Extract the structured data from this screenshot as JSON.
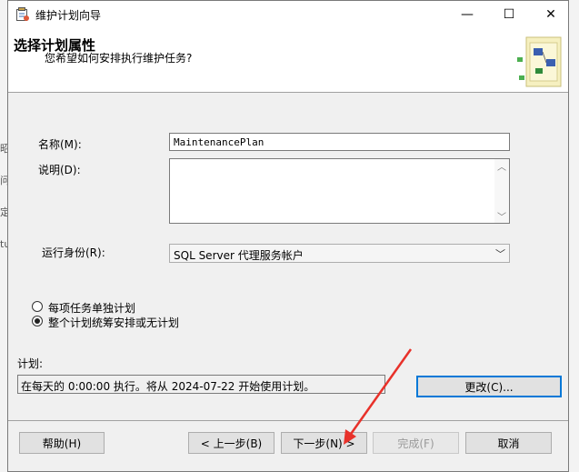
{
  "window": {
    "title": "维护计划向导",
    "controls": {
      "minimize": "—",
      "maximize": "☐",
      "close": "✕"
    }
  },
  "header": {
    "title": "选择计划属性",
    "subtitle": "您希望如何安排执行维护任务?"
  },
  "form": {
    "name_label": "名称(M):",
    "name_value": "MaintenancePlan",
    "description_label": "说明(D):",
    "description_value": "",
    "run_as_label": "运行身份(R):",
    "run_as_value": "SQL Server 代理服务帐户"
  },
  "schedule_options": [
    {
      "label": "每项任务单独计划",
      "selected": false
    },
    {
      "label": "整个计划统筹安排或无计划",
      "selected": true
    }
  ],
  "schedule": {
    "label": "计划:",
    "value": "在每天的 0:00:00 执行。将从 2024-07-22 开始使用计划。",
    "change_button": "更改(C)..."
  },
  "footer": {
    "help": "帮助(H)",
    "back": "< 上一步(B)",
    "next": "下一步(N) >",
    "finish": "完成(F)",
    "cancel": "取消"
  },
  "background_fragments": [
    "昭",
    "问",
    "定",
    "tu"
  ],
  "colors": {
    "accent": "#0078d7",
    "annotation_arrow": "#e8312a"
  }
}
